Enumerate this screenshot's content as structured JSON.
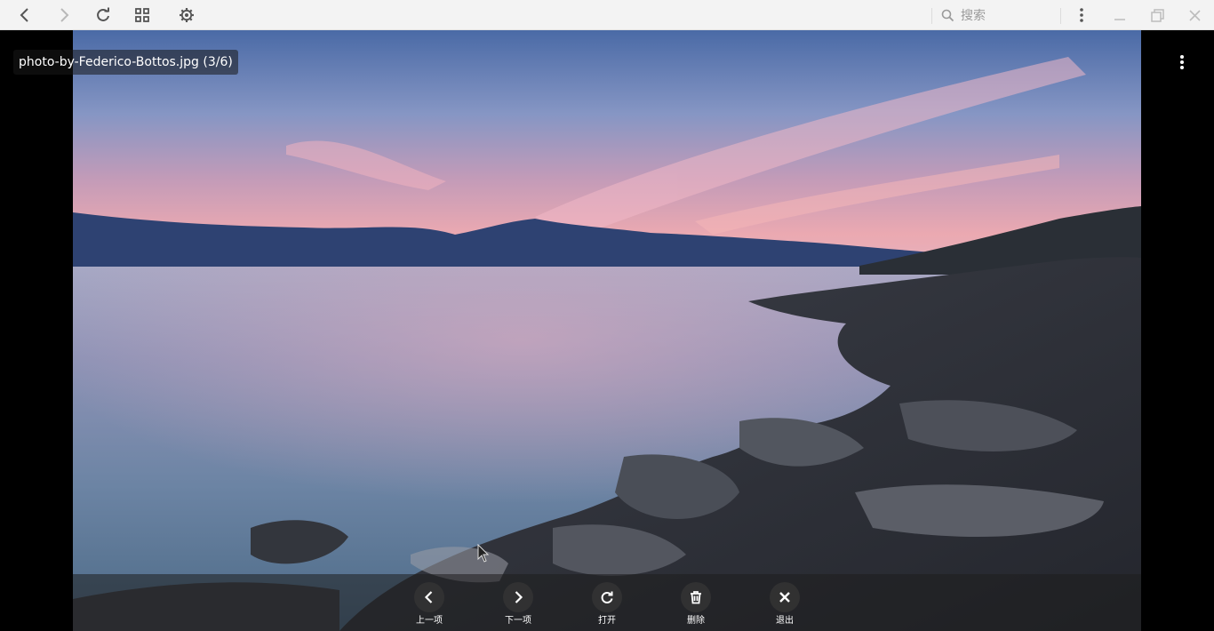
{
  "toolbar": {
    "icons": [
      "back-arrow-icon",
      "forward-arrow-icon",
      "refresh-icon",
      "grid-view-icon",
      "settings-gear-icon",
      "search-icon",
      "more-vertical-icon",
      "minimize-icon",
      "restore-icon",
      "close-icon"
    ],
    "search_placeholder": "搜索"
  },
  "viewer": {
    "file_label": "photo-by-Federico-Bottos.jpg (3/6)",
    "menu_icon": "more-vertical-icon",
    "photo_subject": "sunset-over-sea-with-rocky-shore"
  },
  "actions": [
    {
      "label": "上一项",
      "icon": "chevron-left-icon"
    },
    {
      "label": "下一项",
      "icon": "chevron-right-icon"
    },
    {
      "label": "打开",
      "icon": "open-rotate-icon"
    },
    {
      "label": "删除",
      "icon": "trash-icon"
    },
    {
      "label": "退出",
      "icon": "close-x-icon"
    }
  ],
  "colors": {
    "toolbar_bg": "#f3f3f3",
    "icon_gray": "#666666",
    "viewer_bg": "#000000",
    "action_circle": "#343434"
  }
}
